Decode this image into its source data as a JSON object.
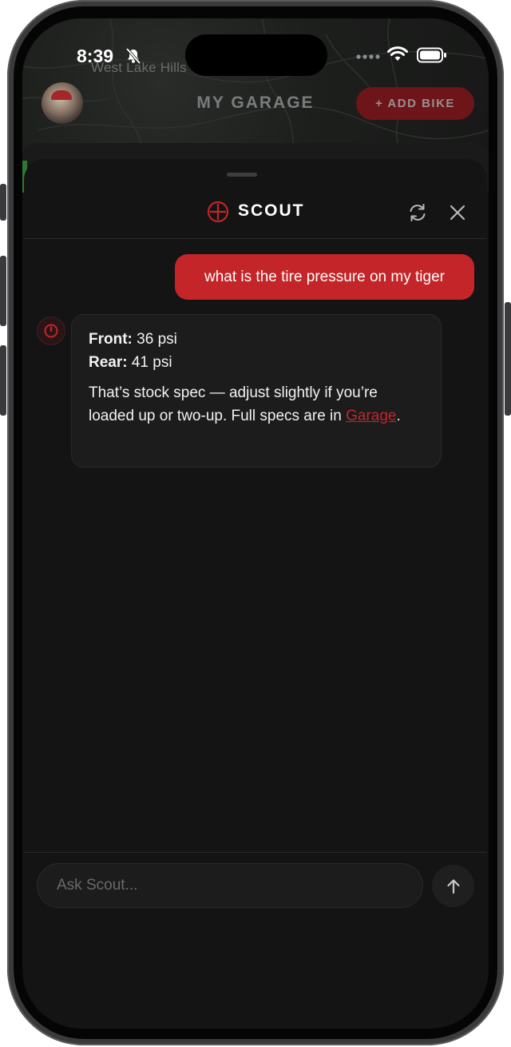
{
  "status_bar": {
    "time": "8:39"
  },
  "map": {
    "place_label": "West Lake Hills"
  },
  "header": {
    "title": "MY GARAGE",
    "add_bike_label": "+ ADD BIKE"
  },
  "chat": {
    "title": "SCOUT",
    "messages": [
      {
        "role": "user",
        "text": "what is the tire pressure on my tiger"
      },
      {
        "role": "assistant",
        "front_label": "Front:",
        "front_value": " 36 psi",
        "rear_label": "Rear:",
        "rear_value": " 41 psi",
        "body_text": "That’s stock spec — adjust slightly if you’re loaded up or two-up. Full specs are in ",
        "link_text": "Garage",
        "body_end": "."
      }
    ],
    "input_placeholder": "Ask Scout..."
  },
  "colors": {
    "accent": "#c42528",
    "background": "#141415",
    "bubble": "#1c1c1d"
  },
  "icons": [
    "bell-slash-icon",
    "signal-icon",
    "wifi-icon",
    "battery-icon",
    "scout-logo-icon",
    "refresh-icon",
    "close-icon",
    "send-arrow-icon"
  ]
}
